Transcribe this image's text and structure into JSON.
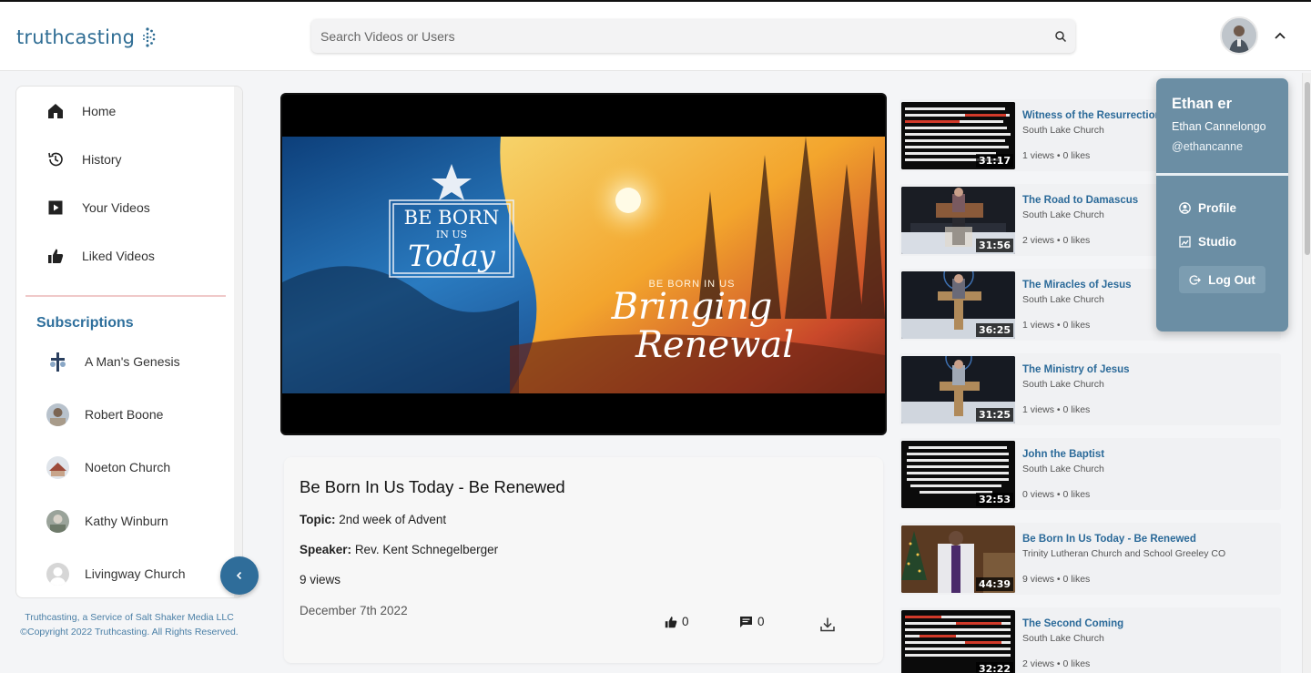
{
  "header": {
    "logo_text": "truthcasting",
    "search_placeholder": "Search Videos or Users"
  },
  "sidebar": {
    "nav": [
      {
        "label": "Home",
        "icon": "home-icon"
      },
      {
        "label": "History",
        "icon": "history-icon"
      },
      {
        "label": "Your Videos",
        "icon": "video-play-icon"
      },
      {
        "label": "Liked Videos",
        "icon": "thumbs-up-icon"
      }
    ],
    "subscriptions_title": "Subscriptions",
    "subscriptions": [
      {
        "label": "A Man's Genesis"
      },
      {
        "label": "Robert Boone"
      },
      {
        "label": "Noeton Church"
      },
      {
        "label": "Kathy Winburn"
      },
      {
        "label": "Livingway Church"
      }
    ],
    "copyright": "Truthcasting, a Service of Salt Shaker Media LLC ©Copyright 2022 Truthcasting. All Rights Reserved."
  },
  "video": {
    "artwork_left_line1": "BE BORN",
    "artwork_left_line2": "IN US",
    "artwork_left_line3": "Today",
    "artwork_small": "BE BORN IN US",
    "artwork_right_line1": "Bringing",
    "artwork_right_line2": "Renewal",
    "title": "Be Born In Us Today - Be Renewed",
    "topic_label": "Topic:",
    "topic": "2nd week of Advent",
    "speaker_label": "Speaker:",
    "speaker": "Rev. Kent Schnegelberger",
    "views": "9 views",
    "date": "December 7th 2022",
    "likes": "0",
    "comments": "0"
  },
  "related": [
    {
      "title": "Witness of the Resurrection",
      "channel": "South Lake Church",
      "stats": "1 views • 0 likes",
      "duration": "31:17"
    },
    {
      "title": "The Road to Damascus",
      "channel": "South Lake Church",
      "stats": "2 views • 0 likes",
      "duration": "31:56"
    },
    {
      "title": "The Miracles of Jesus",
      "channel": "South Lake Church",
      "stats": "1 views • 0 likes",
      "duration": "36:25"
    },
    {
      "title": "The Ministry of Jesus",
      "channel": "South Lake Church",
      "stats": "1 views • 0 likes",
      "duration": "31:25"
    },
    {
      "title": "John the Baptist",
      "channel": "South Lake Church",
      "stats": "0 views • 0 likes",
      "duration": "32:53"
    },
    {
      "title": "Be Born In Us Today - Be Renewed",
      "channel": "Trinity Lutheran Church and School Greeley CO",
      "stats": "9 views • 0 likes",
      "duration": "44:39"
    },
    {
      "title": "The Second Coming",
      "channel": "South Lake Church",
      "stats": "2 views • 0 likes",
      "duration": "32:22"
    }
  ],
  "user_menu": {
    "name": "Ethan er",
    "full_name": "Ethan Cannelongo",
    "handle": "@ethancanne",
    "profile": "Profile",
    "studio": "Studio",
    "logout": "Log Out"
  },
  "colors": {
    "brand": "#2f6d94",
    "menu_bg": "#6b8ea4",
    "link": "#2b6a99"
  }
}
